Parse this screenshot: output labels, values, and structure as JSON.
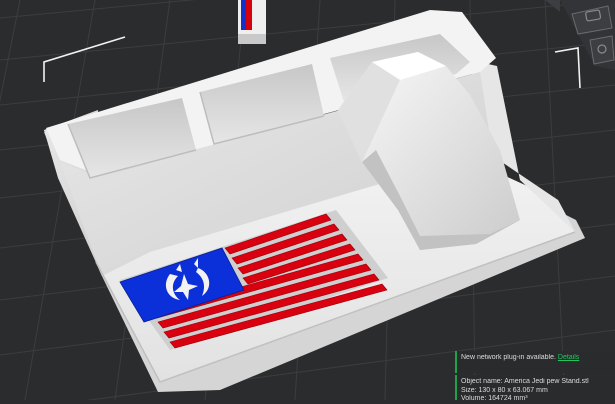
{
  "notifications": {
    "plugin": {
      "message": "New network plug-in available.",
      "link": "Details"
    },
    "object_info": {
      "name_label": "Object name:",
      "name": "America Jedi pew Stand.stl",
      "size_label": "Size:",
      "size": "130 x 80 x 63.067 mm",
      "volume_label": "Volume:",
      "volume": "164724 mm³"
    }
  },
  "colors": {
    "background": "#2b2c2e",
    "plate_lines": "#3c3d40",
    "model": "#eeeeee",
    "flag_red": "#d9000f",
    "flag_blue": "#0b2fd8",
    "accent_green": "#1fa34a"
  },
  "icons": [
    "view-cube-icon",
    "jedi-order-emblem"
  ]
}
